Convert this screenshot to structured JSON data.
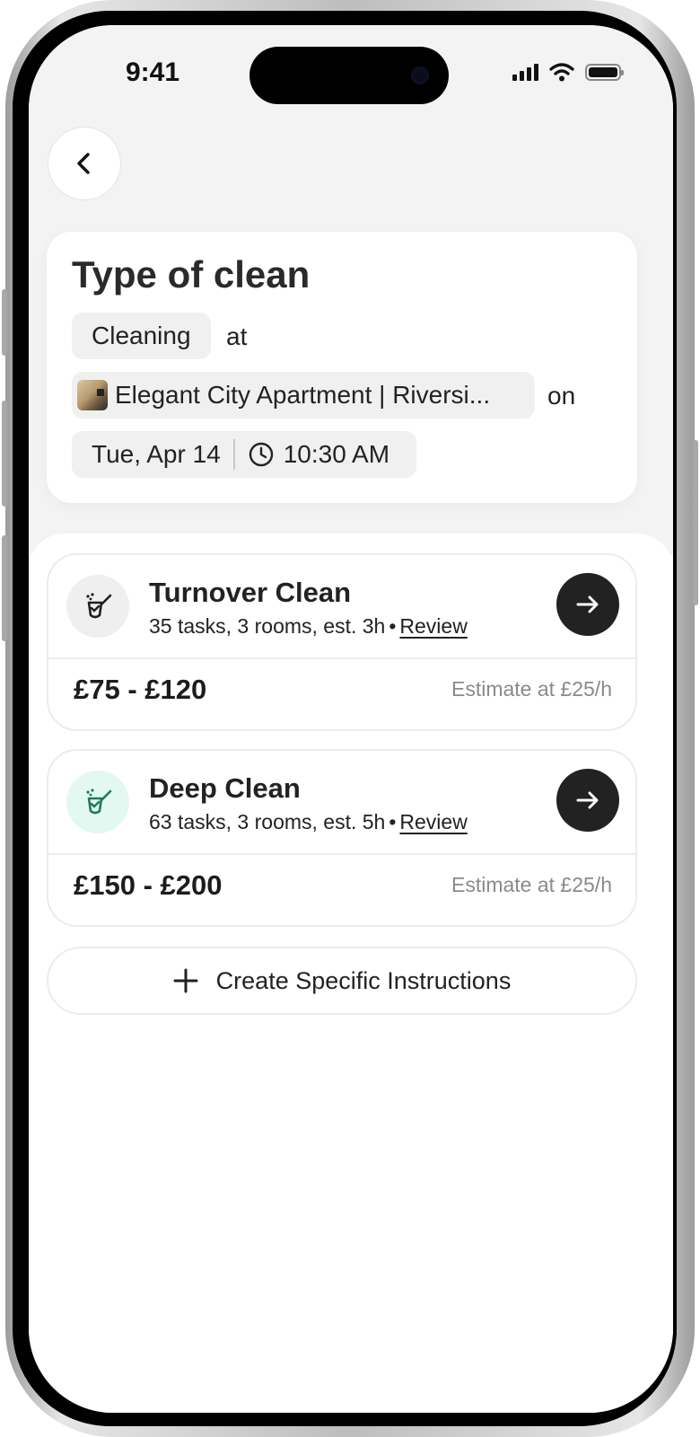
{
  "status_bar": {
    "time": "9:41"
  },
  "header": {
    "back_icon": "chevron-left-icon"
  },
  "summary": {
    "title": "Type of clean",
    "service_chip": "Cleaning",
    "connector_at": "at",
    "property_chip": "Elegant City Apartment | Riversi...",
    "connector_on": "on",
    "date": "Tue, Apr 14",
    "time": "10:30 AM"
  },
  "options": [
    {
      "title": "Turnover Clean",
      "meta": "35 tasks, 3 rooms, est. 3h",
      "review_label": "Review",
      "price": "£75 - £120",
      "estimate": "Estimate at £25/h",
      "icon": "cleaning-spray-icon",
      "icon_bg": "#efefef",
      "icon_color": "#1e1e1e"
    },
    {
      "title": "Deep Clean",
      "meta": "63 tasks, 3 rooms, est. 5h",
      "review_label": "Review",
      "price": "£150 - £200",
      "estimate": "Estimate at £25/h",
      "icon": "cleaning-spray-icon",
      "icon_bg": "#e3f8f1",
      "icon_color": "#1f7a5c"
    }
  ],
  "create_instructions": {
    "label": "Create Specific Instructions",
    "icon": "plus-icon"
  },
  "colors": {
    "accent_dark": "#222222",
    "sheet_bg": "#ffffff",
    "top_bg": "#f3f3f3"
  }
}
